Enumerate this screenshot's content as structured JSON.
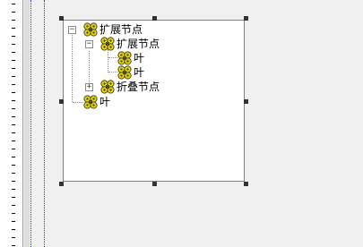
{
  "tree": {
    "root": {
      "label": "扩展节点",
      "expander": "−"
    },
    "child_expanded": {
      "label": "扩展节点",
      "expander": "−"
    },
    "leaf1": {
      "label": "叶"
    },
    "leaf2": {
      "label": "叶"
    },
    "child_collapsed": {
      "label": "折叠节点",
      "expander": "+"
    },
    "leaf_root": {
      "label": "叶"
    }
  },
  "icons": {
    "node": "gear-cluster-icon"
  },
  "colors": {
    "icon_yellow": "#e8d800",
    "icon_dark": "#4a4a2a",
    "guide": "#3333cc"
  }
}
